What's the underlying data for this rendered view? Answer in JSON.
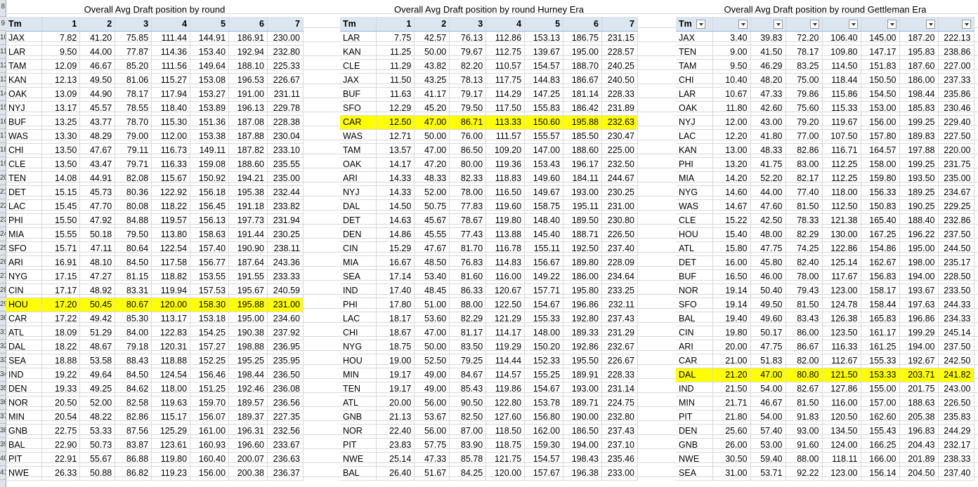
{
  "row_headers": [
    "8",
    "9",
    "10",
    "11",
    "12",
    "13",
    "14",
    "15",
    "16",
    "17",
    "18",
    "19",
    "20",
    "21",
    "22",
    "23",
    "24",
    "25",
    "26",
    "27",
    "28",
    "29",
    "30",
    "31",
    "32",
    "33",
    "34",
    "35",
    "36",
    "37",
    "38",
    "39",
    "40",
    "41"
  ],
  "tables": [
    {
      "title": "Overall Avg Draft position by round",
      "headers": [
        "Tm",
        "1",
        "2",
        "3",
        "4",
        "5",
        "6",
        "7"
      ],
      "highlight_row": 19,
      "rows": [
        [
          "JAX",
          "7.82",
          "41.20",
          "75.85",
          "111.44",
          "144.91",
          "186.91",
          "230.00"
        ],
        [
          "LAR",
          "9.50",
          "44.00",
          "77.87",
          "114.36",
          "153.40",
          "192.94",
          "232.80"
        ],
        [
          "TAM",
          "12.09",
          "46.67",
          "85.20",
          "111.56",
          "149.64",
          "188.10",
          "225.33"
        ],
        [
          "KAN",
          "12.13",
          "49.50",
          "81.06",
          "115.27",
          "153.08",
          "196.53",
          "226.67"
        ],
        [
          "OAK",
          "13.09",
          "44.90",
          "78.17",
          "117.94",
          "153.27",
          "191.00",
          "231.11"
        ],
        [
          "NYJ",
          "13.17",
          "45.57",
          "78.55",
          "118.40",
          "153.89",
          "196.13",
          "229.78"
        ],
        [
          "BUF",
          "13.25",
          "43.77",
          "78.70",
          "115.30",
          "151.36",
          "187.08",
          "228.38"
        ],
        [
          "WAS",
          "13.30",
          "48.29",
          "79.00",
          "112.00",
          "153.38",
          "187.88",
          "230.04"
        ],
        [
          "CHI",
          "13.50",
          "47.67",
          "79.11",
          "116.73",
          "149.11",
          "187.82",
          "233.10"
        ],
        [
          "CLE",
          "13.50",
          "43.47",
          "79.71",
          "116.33",
          "159.08",
          "188.60",
          "235.55"
        ],
        [
          "TEN",
          "14.08",
          "44.91",
          "82.08",
          "115.67",
          "150.92",
          "194.21",
          "235.00"
        ],
        [
          "DET",
          "15.15",
          "45.73",
          "80.36",
          "122.92",
          "156.18",
          "195.38",
          "232.44"
        ],
        [
          "LAC",
          "15.45",
          "47.70",
          "80.08",
          "118.22",
          "156.45",
          "191.18",
          "233.82"
        ],
        [
          "PHI",
          "15.50",
          "47.92",
          "84.88",
          "119.57",
          "156.13",
          "197.73",
          "231.94"
        ],
        [
          "MIA",
          "15.55",
          "50.18",
          "79.50",
          "113.80",
          "158.63",
          "191.44",
          "230.25"
        ],
        [
          "SFO",
          "15.71",
          "47.11",
          "80.64",
          "122.54",
          "157.40",
          "190.90",
          "238.11"
        ],
        [
          "ARI",
          "16.91",
          "48.10",
          "84.50",
          "117.58",
          "156.77",
          "187.64",
          "243.36"
        ],
        [
          "NYG",
          "17.15",
          "47.27",
          "81.15",
          "118.82",
          "153.55",
          "191.55",
          "233.33"
        ],
        [
          "CIN",
          "17.17",
          "48.92",
          "83.31",
          "119.94",
          "157.53",
          "195.67",
          "240.59"
        ],
        [
          "HOU",
          "17.20",
          "50.45",
          "80.67",
          "120.00",
          "158.30",
          "195.88",
          "231.00"
        ],
        [
          "CAR",
          "17.22",
          "49.42",
          "85.30",
          "113.17",
          "153.18",
          "195.00",
          "234.60"
        ],
        [
          "ATL",
          "18.09",
          "51.29",
          "84.00",
          "122.83",
          "154.25",
          "190.38",
          "237.92"
        ],
        [
          "DAL",
          "18.22",
          "48.67",
          "79.18",
          "120.31",
          "157.27",
          "198.88",
          "236.95"
        ],
        [
          "SEA",
          "18.88",
          "53.58",
          "88.43",
          "118.88",
          "152.25",
          "195.25",
          "235.95"
        ],
        [
          "IND",
          "19.22",
          "49.64",
          "84.50",
          "124.54",
          "156.46",
          "198.44",
          "236.50"
        ],
        [
          "DEN",
          "19.33",
          "49.25",
          "84.62",
          "118.00",
          "151.25",
          "192.46",
          "236.08"
        ],
        [
          "NOR",
          "20.50",
          "52.00",
          "82.58",
          "119.63",
          "159.70",
          "189.57",
          "236.56"
        ],
        [
          "MIN",
          "20.54",
          "48.22",
          "82.86",
          "115.17",
          "156.07",
          "189.37",
          "227.35"
        ],
        [
          "GNB",
          "22.75",
          "53.33",
          "87.56",
          "125.29",
          "161.00",
          "196.31",
          "232.56"
        ],
        [
          "BAL",
          "22.90",
          "50.73",
          "83.87",
          "123.61",
          "160.93",
          "196.60",
          "233.67"
        ],
        [
          "PIT",
          "22.91",
          "55.67",
          "86.88",
          "119.80",
          "160.40",
          "200.07",
          "236.63"
        ],
        [
          "NWE",
          "26.33",
          "50.88",
          "86.82",
          "119.23",
          "156.00",
          "200.38",
          "236.37"
        ]
      ]
    },
    {
      "title": "Overall Avg Draft position by round Hurney Era",
      "headers": [
        "Tm",
        "1",
        "2",
        "3",
        "4",
        "5",
        "6",
        "7"
      ],
      "highlight_row": 6,
      "rows": [
        [
          "LAR",
          "7.75",
          "42.57",
          "76.13",
          "112.86",
          "153.13",
          "186.75",
          "231.15"
        ],
        [
          "KAN",
          "11.25",
          "50.00",
          "79.67",
          "112.75",
          "139.67",
          "195.00",
          "228.57"
        ],
        [
          "CLE",
          "11.29",
          "43.82",
          "82.20",
          "110.57",
          "154.57",
          "188.70",
          "240.25"
        ],
        [
          "JAX",
          "11.50",
          "43.25",
          "78.13",
          "117.75",
          "144.83",
          "186.67",
          "240.50"
        ],
        [
          "BUF",
          "11.63",
          "41.17",
          "79.17",
          "114.29",
          "147.25",
          "181.14",
          "228.33"
        ],
        [
          "SFO",
          "12.29",
          "45.20",
          "79.50",
          "117.50",
          "155.83",
          "186.42",
          "231.89"
        ],
        [
          "CAR",
          "12.50",
          "47.00",
          "86.71",
          "113.33",
          "150.60",
          "195.88",
          "232.63"
        ],
        [
          "WAS",
          "12.71",
          "50.00",
          "76.00",
          "111.57",
          "155.57",
          "185.50",
          "230.47"
        ],
        [
          "TAM",
          "13.57",
          "47.00",
          "86.50",
          "109.20",
          "147.00",
          "188.60",
          "225.00"
        ],
        [
          "OAK",
          "14.17",
          "47.20",
          "80.00",
          "119.36",
          "153.43",
          "196.17",
          "232.50"
        ],
        [
          "ARI",
          "14.33",
          "48.33",
          "82.33",
          "118.83",
          "149.60",
          "184.11",
          "244.67"
        ],
        [
          "NYJ",
          "14.33",
          "52.00",
          "78.00",
          "116.50",
          "149.67",
          "193.00",
          "230.25"
        ],
        [
          "DAL",
          "14.50",
          "50.75",
          "77.83",
          "119.60",
          "158.75",
          "195.11",
          "231.00"
        ],
        [
          "DET",
          "14.63",
          "45.67",
          "78.67",
          "119.80",
          "148.40",
          "189.50",
          "230.80"
        ],
        [
          "DEN",
          "14.86",
          "45.55",
          "77.43",
          "113.88",
          "145.40",
          "188.71",
          "226.50"
        ],
        [
          "CIN",
          "15.29",
          "47.67",
          "81.70",
          "116.78",
          "155.11",
          "192.50",
          "237.40"
        ],
        [
          "MIA",
          "16.67",
          "48.50",
          "76.83",
          "114.83",
          "156.67",
          "189.80",
          "228.09"
        ],
        [
          "SEA",
          "17.14",
          "53.40",
          "81.60",
          "116.00",
          "149.22",
          "186.00",
          "234.64"
        ],
        [
          "IND",
          "17.40",
          "48.45",
          "86.33",
          "120.67",
          "157.71",
          "195.80",
          "233.25"
        ],
        [
          "PHI",
          "17.80",
          "51.00",
          "88.00",
          "122.50",
          "154.67",
          "196.86",
          "232.11"
        ],
        [
          "LAC",
          "18.17",
          "53.60",
          "82.29",
          "121.29",
          "155.33",
          "192.80",
          "237.43"
        ],
        [
          "CHI",
          "18.67",
          "47.00",
          "81.17",
          "114.17",
          "148.00",
          "189.33",
          "231.29"
        ],
        [
          "NYG",
          "18.75",
          "50.00",
          "83.50",
          "119.29",
          "150.20",
          "192.86",
          "232.67"
        ],
        [
          "HOU",
          "19.00",
          "52.50",
          "79.25",
          "114.44",
          "152.33",
          "195.50",
          "226.67"
        ],
        [
          "MIN",
          "19.17",
          "49.00",
          "84.67",
          "114.57",
          "155.25",
          "189.91",
          "228.33"
        ],
        [
          "TEN",
          "19.17",
          "49.00",
          "85.43",
          "119.86",
          "154.67",
          "193.00",
          "231.14"
        ],
        [
          "ATL",
          "20.00",
          "56.00",
          "90.50",
          "122.80",
          "153.78",
          "189.71",
          "224.75"
        ],
        [
          "GNB",
          "21.13",
          "53.67",
          "82.50",
          "127.60",
          "156.80",
          "190.00",
          "232.80"
        ],
        [
          "NOR",
          "22.40",
          "56.00",
          "87.00",
          "118.50",
          "162.00",
          "186.50",
          "237.43"
        ],
        [
          "PIT",
          "23.83",
          "57.75",
          "83.90",
          "118.75",
          "159.30",
          "194.00",
          "237.10"
        ],
        [
          "NWE",
          "25.14",
          "47.33",
          "85.78",
          "121.75",
          "154.57",
          "198.43",
          "235.46"
        ],
        [
          "BAL",
          "26.40",
          "51.67",
          "84.25",
          "120.00",
          "157.67",
          "196.38",
          "233.00"
        ]
      ]
    },
    {
      "title": "Overall Avg Draft position by round Gettleman Era",
      "headers": [
        "Tm",
        "",
        "",
        "",
        "",
        "",
        "",
        ""
      ],
      "highlight_row": 24,
      "rows": [
        [
          "JAX",
          "3.40",
          "39.83",
          "72.20",
          "106.40",
          "145.00",
          "187.20",
          "222.13"
        ],
        [
          "TEN",
          "9.00",
          "41.50",
          "78.17",
          "109.80",
          "147.17",
          "195.83",
          "238.86"
        ],
        [
          "TAM",
          "9.50",
          "46.29",
          "83.25",
          "114.50",
          "151.83",
          "187.60",
          "227.00"
        ],
        [
          "CHI",
          "10.40",
          "48.20",
          "75.00",
          "118.44",
          "150.50",
          "186.00",
          "237.33"
        ],
        [
          "LAR",
          "10.67",
          "47.33",
          "79.86",
          "115.86",
          "154.50",
          "198.44",
          "235.86"
        ],
        [
          "OAK",
          "11.80",
          "42.60",
          "75.60",
          "115.33",
          "153.00",
          "185.83",
          "230.46"
        ],
        [
          "NYJ",
          "12.00",
          "43.00",
          "79.20",
          "119.67",
          "156.00",
          "199.25",
          "229.40"
        ],
        [
          "LAC",
          "12.20",
          "41.80",
          "77.00",
          "107.50",
          "157.80",
          "189.83",
          "227.50"
        ],
        [
          "KAN",
          "13.00",
          "48.33",
          "82.86",
          "116.71",
          "164.57",
          "197.88",
          "220.00"
        ],
        [
          "PHI",
          "13.20",
          "41.75",
          "83.00",
          "112.25",
          "158.00",
          "199.25",
          "231.75"
        ],
        [
          "MIA",
          "14.20",
          "52.20",
          "82.17",
          "112.25",
          "159.80",
          "193.50",
          "235.00"
        ],
        [
          "NYG",
          "14.60",
          "44.00",
          "77.40",
          "118.00",
          "156.33",
          "189.25",
          "234.67"
        ],
        [
          "WAS",
          "14.67",
          "47.60",
          "81.50",
          "112.50",
          "150.83",
          "190.25",
          "229.25"
        ],
        [
          "CLE",
          "15.22",
          "42.50",
          "78.33",
          "121.38",
          "165.40",
          "188.40",
          "232.86"
        ],
        [
          "HOU",
          "15.40",
          "48.00",
          "82.29",
          "130.00",
          "167.25",
          "196.22",
          "237.50"
        ],
        [
          "ATL",
          "15.80",
          "47.75",
          "74.25",
          "122.86",
          "154.86",
          "195.00",
          "244.50"
        ],
        [
          "DET",
          "16.00",
          "45.80",
          "82.40",
          "125.14",
          "162.67",
          "198.00",
          "235.17"
        ],
        [
          "BUF",
          "16.50",
          "46.00",
          "78.00",
          "117.67",
          "156.83",
          "194.00",
          "228.50"
        ],
        [
          "NOR",
          "19.14",
          "50.40",
          "79.43",
          "123.00",
          "158.17",
          "193.67",
          "233.50"
        ],
        [
          "SFO",
          "19.14",
          "49.50",
          "81.50",
          "124.78",
          "158.44",
          "197.63",
          "244.33"
        ],
        [
          "BAL",
          "19.40",
          "49.60",
          "83.43",
          "126.38",
          "165.83",
          "196.86",
          "234.33"
        ],
        [
          "CIN",
          "19.80",
          "50.17",
          "86.00",
          "123.50",
          "161.17",
          "199.29",
          "245.14"
        ],
        [
          "ARI",
          "20.00",
          "47.75",
          "86.67",
          "116.33",
          "161.25",
          "194.00",
          "237.50"
        ],
        [
          "CAR",
          "21.00",
          "51.83",
          "82.00",
          "112.67",
          "155.33",
          "192.67",
          "242.50"
        ],
        [
          "DAL",
          "21.20",
          "47.00",
          "80.80",
          "121.50",
          "153.33",
          "203.71",
          "241.82"
        ],
        [
          "IND",
          "21.50",
          "54.00",
          "82.67",
          "127.86",
          "155.00",
          "201.75",
          "243.00"
        ],
        [
          "MIN",
          "21.71",
          "46.67",
          "81.50",
          "116.00",
          "157.00",
          "188.63",
          "226.50"
        ],
        [
          "PIT",
          "21.80",
          "54.00",
          "91.83",
          "120.50",
          "162.60",
          "205.38",
          "235.83"
        ],
        [
          "DEN",
          "25.60",
          "57.40",
          "93.00",
          "134.50",
          "155.43",
          "196.83",
          "244.29"
        ],
        [
          "GNB",
          "26.00",
          "53.00",
          "91.60",
          "124.00",
          "166.25",
          "204.43",
          "232.17"
        ],
        [
          "NWE",
          "30.50",
          "59.40",
          "88.00",
          "118.11",
          "166.00",
          "201.89",
          "238.33"
        ],
        [
          "SEA",
          "31.00",
          "53.71",
          "92.22",
          "123.00",
          "156.14",
          "204.50",
          "237.40"
        ]
      ]
    }
  ]
}
